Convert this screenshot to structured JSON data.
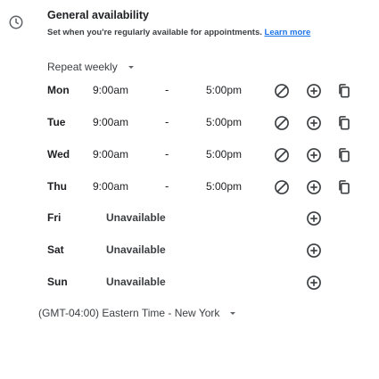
{
  "header": {
    "title": "General availability",
    "description": "Set when you're regularly available for appointments.",
    "learn_more": "Learn more"
  },
  "repeat": {
    "label": "Repeat weekly"
  },
  "days": [
    {
      "day": "Mon",
      "start": "9:00am",
      "sep": "-",
      "end": "5:00pm"
    },
    {
      "day": "Tue",
      "start": "9:00am",
      "sep": "-",
      "end": "5:00pm"
    },
    {
      "day": "Wed",
      "start": "9:00am",
      "sep": "-",
      "end": "5:00pm"
    },
    {
      "day": "Thu",
      "start": "9:00am",
      "sep": "-",
      "end": "5:00pm"
    },
    {
      "day": "Fri",
      "status": "Unavailable"
    },
    {
      "day": "Sat",
      "status": "Unavailable"
    },
    {
      "day": "Sun",
      "status": "Unavailable"
    }
  ],
  "timezone": {
    "label": "(GMT-04:00) Eastern Time - New York"
  },
  "icons": {
    "clock": "clock-icon",
    "remove": "block-icon",
    "add": "add-circle-icon",
    "copy": "copy-icon",
    "dropdown": "caret-down-icon"
  },
  "colors": {
    "text": "#202124",
    "muted": "#3c4043",
    "link": "#1a73e8",
    "icon": "#3c4043"
  }
}
